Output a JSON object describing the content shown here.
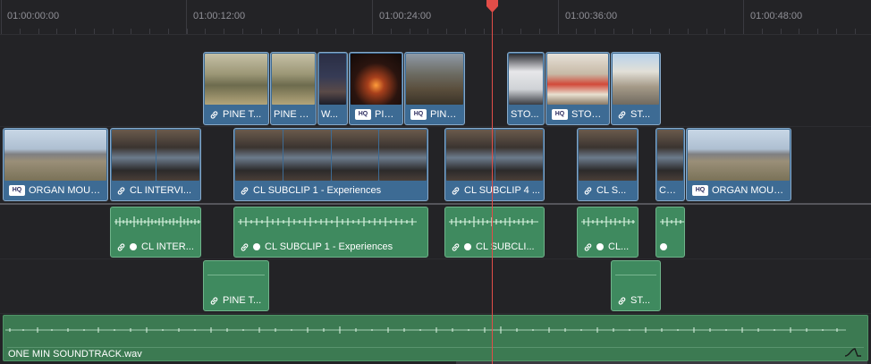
{
  "ruler": {
    "timecodes": [
      "01:00:00:00",
      "01:00:12:00",
      "01:00:24:00",
      "01:00:36:00",
      "01:00:48:00"
    ]
  },
  "video_track_2": [
    {
      "name": "PINE T...",
      "icon": "link-icon",
      "thumb": "t-trail",
      "thumbs": 1
    },
    {
      "name": "PINE T...",
      "icon": "",
      "thumb": "t-trail",
      "thumbs": 1
    },
    {
      "name": "W...",
      "icon": "",
      "thumb": "t-dark",
      "thumbs": 1
    },
    {
      "name": "PIN...",
      "icon": "hq-icon",
      "thumb": "t-fire",
      "thumbs": 1
    },
    {
      "name": "PINA ...",
      "icon": "hq-icon",
      "thumb": "t-mountain",
      "thumbs": 1
    },
    {
      "name": "STO...",
      "icon": "",
      "thumb": "t-white",
      "thumbs": 1
    },
    {
      "name": "STOR...",
      "icon": "hq-icon",
      "thumb": "t-store",
      "thumbs": 1
    },
    {
      "name": "ST...",
      "icon": "link-icon",
      "thumb": "t-street",
      "thumbs": 1
    }
  ],
  "video_track_1": [
    {
      "name": "ORGAN MOUN...",
      "icon": "hq-icon",
      "thumb": "t-desert",
      "thumbs": 1
    },
    {
      "name": "CL INTERVI...",
      "icon": "link-icon",
      "thumb": "t-shop",
      "thumbs": 2
    },
    {
      "name": "CL SUBCLIP 1 - Experiences",
      "icon": "link-icon",
      "thumb": "t-shop",
      "thumbs": 4
    },
    {
      "name": "CL SUBCLIP 4 ...",
      "icon": "link-icon",
      "thumb": "t-shop",
      "thumbs": 2
    },
    {
      "name": "CL S...",
      "icon": "link-icon",
      "thumb": "t-shop",
      "thumbs": 1
    },
    {
      "name": "CL ...",
      "icon": "",
      "thumb": "t-shop",
      "thumbs": 1
    },
    {
      "name": "ORGAN MOUN...",
      "icon": "hq-icon",
      "thumb": "t-desert",
      "thumbs": 1
    }
  ],
  "audio_track_1": [
    {
      "name": "CL INTER...",
      "dot": true
    },
    {
      "name": "CL SUBCLIP 1 - Experiences",
      "dot": true
    },
    {
      "name": "CL SUBCLI...",
      "dot": true
    },
    {
      "name": "CL...",
      "dot": true
    },
    {
      "name": "",
      "dot": true
    }
  ],
  "audio_track_2": [
    {
      "name": "PINE T..."
    },
    {
      "name": "ST..."
    }
  ],
  "music_track": {
    "name": "ONE MIN SOUNDTRACK.wav"
  },
  "colors": {
    "video_clip": "#3d6b94",
    "audio_clip": "#3f8a5f",
    "playhead": "#e24d48"
  }
}
